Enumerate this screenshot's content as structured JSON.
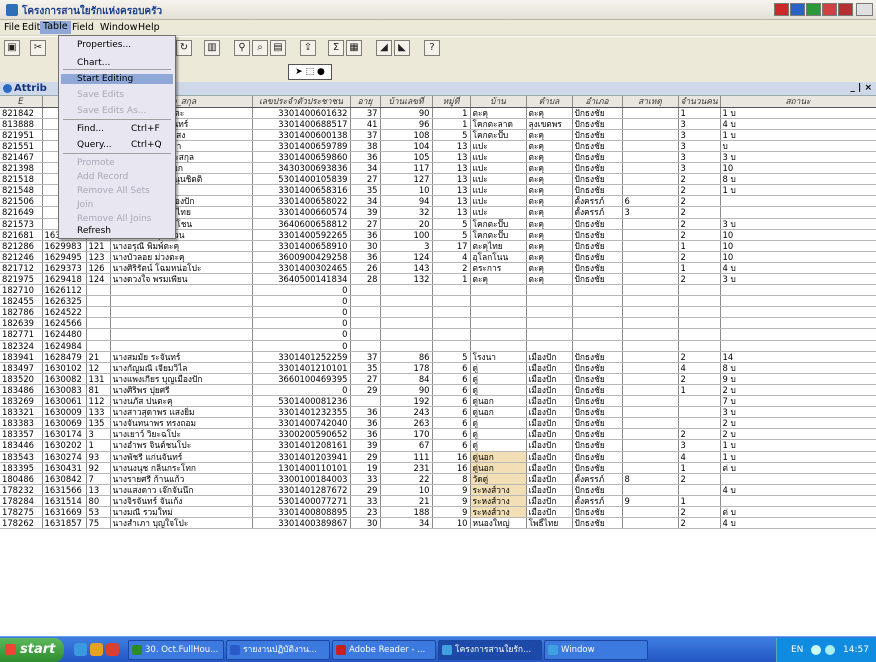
{
  "window": {
    "title": "โครงการสานใยรักแห่งครอบครัว"
  },
  "menubar": [
    "File",
    "Edit",
    "Table",
    "Field",
    "Window",
    "Help"
  ],
  "table_menu": {
    "items": [
      {
        "label": "Properties...",
        "shortcut": "",
        "enabled": true
      },
      {
        "label": "Chart...",
        "shortcut": "",
        "enabled": true
      },
      {
        "label": "Start Editing",
        "shortcut": "",
        "enabled": true,
        "highlighted": true
      },
      {
        "label": "Save Edits",
        "shortcut": "",
        "enabled": false
      },
      {
        "label": "Save Edits As...",
        "shortcut": "",
        "enabled": false
      },
      {
        "label": "Find...",
        "shortcut": "Ctrl+F",
        "enabled": true
      },
      {
        "label": "Query...",
        "shortcut": "Ctrl+Q",
        "enabled": true
      },
      {
        "label": "Promote",
        "shortcut": "",
        "enabled": false
      },
      {
        "label": "Add Record",
        "shortcut": "",
        "enabled": false
      },
      {
        "label": "Remove All Sets",
        "shortcut": "",
        "enabled": false
      },
      {
        "label": "Join",
        "shortcut": "",
        "enabled": false
      },
      {
        "label": "Remove All Joins",
        "shortcut": "",
        "enabled": false
      },
      {
        "label": "Refresh",
        "shortcut": "",
        "enabled": true
      }
    ]
  },
  "attributes": {
    "title": "Attrib",
    "controls": "_ | ×",
    "columns": [
      "E",
      "",
      "",
      "ชื่อ_สกุล",
      "เลขประจำตัวประชาชน",
      "อายุ",
      "บ้านเลขที่",
      "หมู่ที่",
      "บ้าน",
      "ตำบล",
      "อำเภอ",
      "สาเหตุ",
      "จำนวนคน",
      "สถานะ"
    ],
    "rows": [
      [
        "821842",
        "",
        "",
        "นางไพรินทร์ แสงตะ",
        "3301400601632",
        "37",
        "90",
        "1",
        "ตะคุ",
        "ตะคุ",
        "ปักธงชัย",
        "",
        "1",
        "1 บ"
      ],
      [
        "813888",
        "",
        "",
        "นายนงนุช กลิ่นจันทร์",
        "3301400688517",
        "41",
        "96",
        "1",
        "โคกตะลาด",
        "ลุงเขตพร",
        "ปักธงชัย",
        "",
        "3",
        "4 บ"
      ],
      [
        "821951",
        "",
        "",
        "นางสุภาวิตร์ ปั่นแสง",
        "3301400600138",
        "37",
        "108",
        "5",
        "โคกตะปั๊บ",
        "ตะคุ",
        "ปักธงชัย",
        "",
        "3",
        "1 บ"
      ],
      [
        "821551",
        "",
        "",
        "นายจับ ขวัญเชงชา",
        "3301400659789",
        "38",
        "104",
        "13",
        "แปะ",
        "ตะคุ",
        "ปักธงชัย",
        "",
        "3",
        "บ"
      ],
      [
        "821467",
        "",
        "",
        "นางเกศนียา ยิมมะสกุล",
        "3301400659860",
        "36",
        "105",
        "13",
        "แปะ",
        "ตะคุ",
        "ปักธงชัย",
        "",
        "3",
        "3 บ"
      ],
      [
        "821398",
        "",
        "",
        "นางสมภาร แตงเอก",
        "3430300693836",
        "34",
        "117",
        "13",
        "แปะ",
        "ตะคุ",
        "ปักธงชัย",
        "",
        "3",
        "10"
      ],
      [
        "821518",
        "",
        "",
        "นางสาวอวาห ทะนุนชิตติ",
        "5301400105839",
        "27",
        "127",
        "13",
        "แปะ",
        "ตะคุ",
        "ปักธงชัย",
        "",
        "2",
        "8 บ"
      ],
      [
        "821548",
        "",
        "",
        "นางบุปผา ไม้ตะคุ",
        "3301400658316",
        "35",
        "10",
        "13",
        "แปะ",
        "ตะคุ",
        "ปักธงชัย",
        "",
        "2",
        "1 บ"
      ],
      [
        "821506",
        "",
        "",
        "นางนงค์นุช บัวเมืองปัก",
        "3301400658022",
        "34",
        "94",
        "13",
        "แปะ",
        "ตะคุ",
        "ตั้งครรภ์",
        "6",
        "2",
        ""
      ],
      [
        "821649",
        "",
        "",
        "นางจักนา พันธ์ชงไทย",
        "3301400660574",
        "39",
        "32",
        "13",
        "แปะ",
        "ตะคุ",
        "ตั้งครรภ์",
        "3",
        "2",
        ""
      ],
      [
        "821573",
        "",
        "",
        "นางวิมเพ็ญ จินดาโชน",
        "3640600658812",
        "27",
        "20",
        "5",
        "โคกตะปั๊บ",
        "ตะคุ",
        "ปักธงชัย",
        "",
        "2",
        "3 บ"
      ],
      [
        "821681",
        "1630176",
        "99",
        "นางสายฝน พุทธเวน",
        "3301400592265",
        "36",
        "100",
        "5",
        "โคกตะปั๊บ",
        "ตะคุ",
        "ปักธงชัย",
        "",
        "2",
        "10"
      ],
      [
        "821286",
        "1629983",
        "121",
        "นางอรุณี พิมพ์ตะคุ",
        "3301400658910",
        "30",
        "3",
        "17",
        "ตะคุไทย",
        "ตะคุ",
        "ปักธงชัย",
        "",
        "1",
        "10"
      ],
      [
        "821246",
        "1629495",
        "123",
        "นางบัวลอย ม่วงตะคุ",
        "3600900429258",
        "36",
        "124",
        "4",
        "อุโลกโนน",
        "ตะคุ",
        "ปักธงชัย",
        "",
        "2",
        "10"
      ],
      [
        "821712",
        "1629373",
        "126",
        "นางศิริรัตน์ โฉมหน่อโปะ",
        "3301400302465",
        "26",
        "143",
        "2",
        "ตระการ",
        "ตะคุ",
        "ปักธงชัย",
        "",
        "1",
        "4 บ"
      ],
      [
        "821975",
        "1629418",
        "124",
        "นางดวงใจ พรมเพียน",
        "3640500141834",
        "28",
        "132",
        "1",
        "ตะคุ",
        "ตะคุ",
        "ปักธงชัย",
        "",
        "2",
        "3 บ"
      ],
      [
        "182710",
        "1626112",
        "",
        "",
        "0",
        "",
        "",
        "",
        "",
        "",
        "",
        "",
        "",
        ""
      ],
      [
        "182455",
        "1626325",
        "",
        "",
        "0",
        "",
        "",
        "",
        "",
        "",
        "",
        "",
        "",
        ""
      ],
      [
        "182786",
        "1624522",
        "",
        "",
        "0",
        "",
        "",
        "",
        "",
        "",
        "",
        "",
        "",
        ""
      ],
      [
        "182639",
        "1624566",
        "",
        "",
        "0",
        "",
        "",
        "",
        "",
        "",
        "",
        "",
        "",
        ""
      ],
      [
        "182771",
        "1624480",
        "",
        "",
        "0",
        "",
        "",
        "",
        "",
        "",
        "",
        "",
        "",
        ""
      ],
      [
        "182324",
        "1624984",
        "",
        "",
        "0",
        "",
        "",
        "",
        "",
        "",
        "",
        "",
        "",
        ""
      ],
      [
        "183941",
        "1628479",
        "21",
        "นางสมมัย ระจันทร์",
        "3301401252259",
        "37",
        "86",
        "5",
        "โรงนา",
        "เมืองปัก",
        "ปักธงชัย",
        "",
        "2",
        "14"
      ],
      [
        "183497",
        "1630102",
        "12",
        "นางกัญมณี เจียมวิไล",
        "3301401210101",
        "35",
        "178",
        "6",
        "ดู่",
        "เมืองปัก",
        "ปักธงชัย",
        "",
        "4",
        "8 บ"
      ],
      [
        "183520",
        "1630082",
        "131",
        "นางแพงเกียร บุญเมืองปัก",
        "3660100469395",
        "27",
        "84",
        "6",
        "ดู่",
        "เมืองปัก",
        "ปักธงชัย",
        "",
        "2",
        "9 บ"
      ],
      [
        "183486",
        "1630083",
        "81",
        "นางศิริพร ปุยศรี",
        "0",
        "29",
        "90",
        "6",
        "ดู่",
        "เมืองปัก",
        "ปักธงชัย",
        "",
        "1",
        "2 บ"
      ],
      [
        "183269",
        "1630061",
        "112",
        "นางนภัส ปนตะคุ",
        "5301400081236",
        "",
        "192",
        "6",
        "ดู่นอก",
        "เมืองปัก",
        "ปักธงชัย",
        "",
        "",
        "7 บ"
      ],
      [
        "183321",
        "1630009",
        "133",
        "นางสาวสุดาพร แสงยิ่ม",
        "3301401232355",
        "36",
        "243",
        "6",
        "ดู่นอก",
        "เมืองปัก",
        "ปักธงชัย",
        "",
        "",
        "3 บ"
      ],
      [
        "183383",
        "1630069",
        "135",
        "นางจันทนาพร ทรงถอม",
        "3301400742040",
        "36",
        "263",
        "6",
        "ดู่",
        "เมืองปัก",
        "ปักธงชัย",
        "",
        "",
        "2 บ"
      ],
      [
        "183357",
        "1630174",
        "3",
        "นางเยาว์ วิยะฉโปะ",
        "3300200590652",
        "36",
        "170",
        "6",
        "ดู่",
        "เมืองปัก",
        "ปักธงชัย",
        "",
        "2",
        "2 บ"
      ],
      [
        "183446",
        "1630202",
        "1",
        "นางอำพร จินต์ชนโปะ",
        "3301401208161",
        "39",
        "67",
        "6",
        "ดู่",
        "เมืองปัก",
        "ปักธงชัย",
        "",
        "3",
        "1 บ"
      ],
      [
        "183543",
        "1630274",
        "93",
        "นางพัชรี แก่นจันทร์",
        "3301401203941",
        "29",
        "111",
        "16",
        "ดู่นอก",
        "เมืองปัก",
        "ปักธงชัย",
        "",
        "4",
        "1 บ"
      ],
      [
        "183395",
        "1630431",
        "92",
        "นางนงนุช กลิ่นกระโทก",
        "1301400110101",
        "19",
        "231",
        "16",
        "ดู่นอก",
        "เมืองปัก",
        "ปักธงชัย",
        "",
        "1",
        "ต่ บ"
      ],
      [
        "180486",
        "1630842",
        "7",
        "นางรายศรี ก้านแก้ว",
        "3300100184003",
        "33",
        "22",
        "8",
        "วัดดู่",
        "เมืองปัก",
        "ตั้งครรภ์",
        "8",
        "2",
        ""
      ],
      [
        "178232",
        "1631566",
        "13",
        "นางแสงดาว เจ๊กจันนึก",
        "3301401287672",
        "29",
        "10",
        "9",
        "ระหงส์วาง",
        "เมืองปัก",
        "ปักธงชัย",
        "",
        "",
        "4 บ"
      ],
      [
        "178284",
        "1631514",
        "80",
        "นางจิรจันทร์ จันเก้ง",
        "5301400077271",
        "33",
        "21",
        "9",
        "ระหงส์วาง",
        "เมืองปัก",
        "ตั้งครรภ์",
        "9",
        "1",
        ""
      ],
      [
        "178275",
        "1631669",
        "53",
        "นางมณี รวมใหม่",
        "3301400808895",
        "23",
        "188",
        "9",
        "ระหงส์วาง",
        "เมืองปัก",
        "ปักธงชัย",
        "",
        "2",
        "ต่ บ"
      ],
      [
        "178262",
        "1631857",
        "75",
        "นางสำเภา บุญใจโปะ",
        "3301400389867",
        "30",
        "34",
        "10",
        "หนองใหญ่",
        "โพธิ์ไทย",
        "ปักธงชัย",
        "",
        "2",
        "4 บ"
      ]
    ]
  },
  "taskbar": {
    "start_label": "start",
    "tasks": [
      {
        "label": "30. Oct.FullHou..."
      },
      {
        "label": "รายงานปฏิบัติงาน..."
      },
      {
        "label": "Adobe Reader - ..."
      },
      {
        "label": "โครงการสานใยรัก..."
      },
      {
        "label": "Window"
      }
    ],
    "tray_lang": "EN",
    "clock": "14:57"
  }
}
